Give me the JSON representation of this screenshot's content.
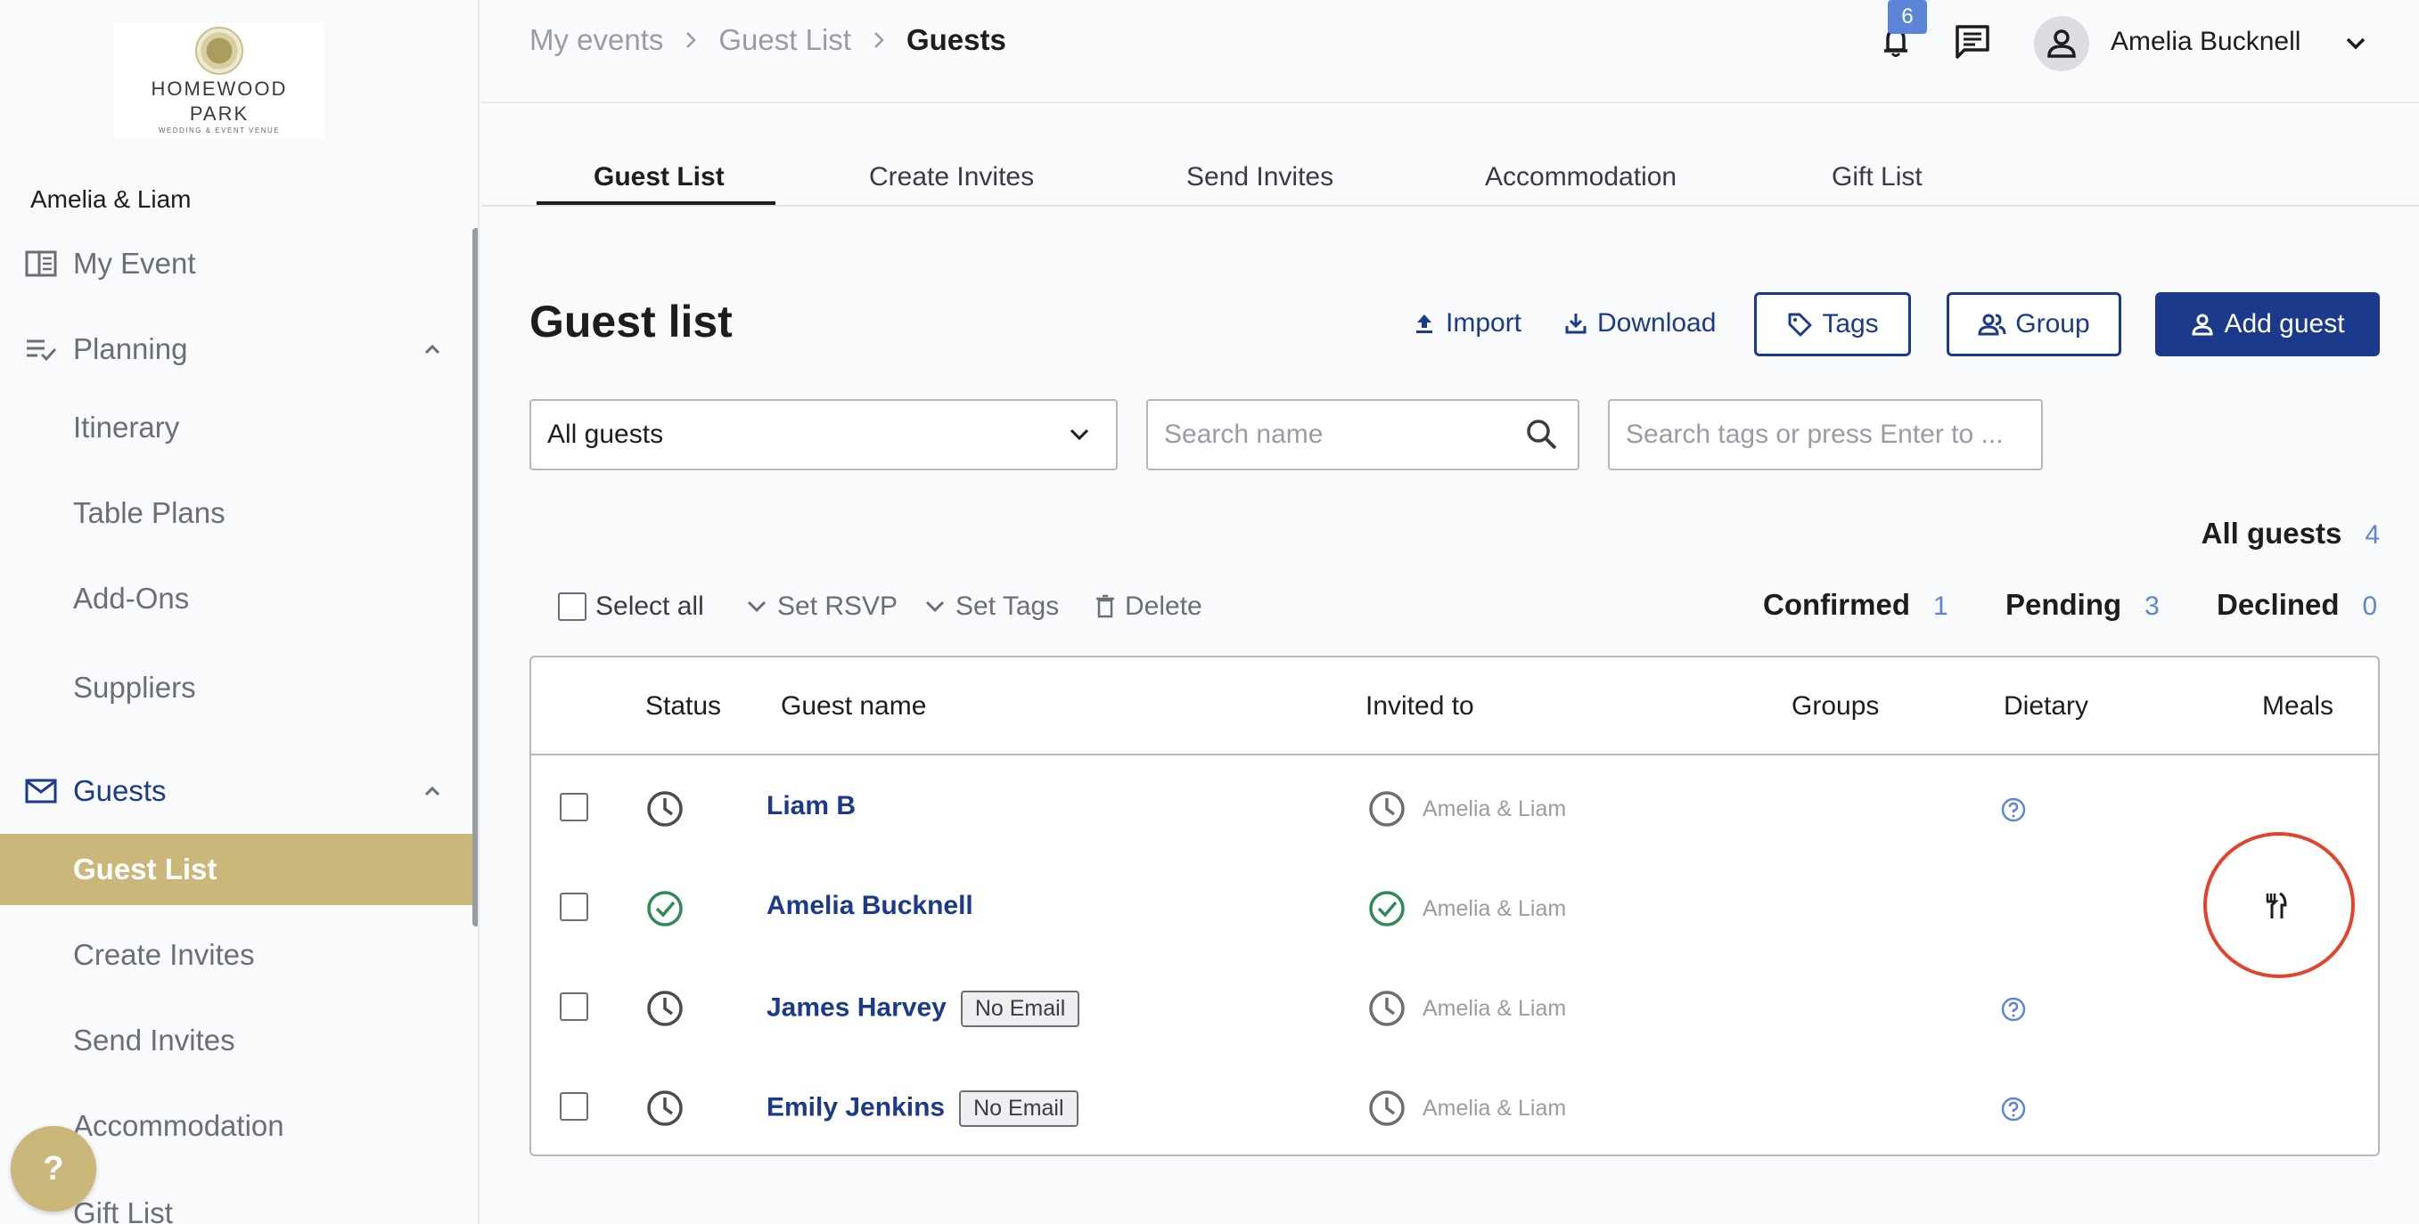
{
  "sidebar": {
    "logo": {
      "line1": "HOMEWOOD",
      "line2": "PARK",
      "tagline": "WEDDING & EVENT VENUE"
    },
    "event_name": "Amelia & Liam",
    "items": [
      {
        "label": "My Event",
        "icon": "book-open-icon"
      },
      {
        "label": "Planning",
        "icon": "checklist-icon"
      },
      {
        "label": "Itinerary"
      },
      {
        "label": "Table Plans"
      },
      {
        "label": "Add-Ons"
      },
      {
        "label": "Suppliers"
      },
      {
        "label": "Guests",
        "icon": "mail-icon"
      },
      {
        "label": "Guest List"
      },
      {
        "label": "Create Invites"
      },
      {
        "label": "Send Invites"
      },
      {
        "label": "Accommodation"
      },
      {
        "label": "Gift List"
      }
    ],
    "help_label": "?"
  },
  "topbar": {
    "breadcrumb": [
      "My events",
      "Guest List",
      "Guests"
    ],
    "notification_count": "6",
    "user_name": "Amelia Bucknell"
  },
  "tabs": [
    "Guest List",
    "Create Invites",
    "Send Invites",
    "Accommodation",
    "Gift List"
  ],
  "main": {
    "title": "Guest list",
    "actions": {
      "import": "Import",
      "download": "Download",
      "tags": "Tags",
      "group": "Group",
      "add_guest": "Add guest"
    },
    "filter_select": "All guests",
    "search_name_placeholder": "Search name",
    "search_tags_placeholder": "Search tags or press Enter to ...",
    "counts": {
      "all_label": "All guests",
      "all": "4",
      "confirmed_label": "Confirmed",
      "confirmed": "1",
      "pending_label": "Pending",
      "pending": "3",
      "declined_label": "Declined",
      "declined": "0"
    },
    "bulk": {
      "select_all": "Select all",
      "set_rsvp": "Set RSVP",
      "set_tags": "Set Tags",
      "delete": "Delete"
    },
    "table": {
      "columns": [
        "Status",
        "Guest name",
        "Invited to",
        "Groups",
        "Dietary",
        "Meals"
      ],
      "rows": [
        {
          "status": "pending",
          "name": "Liam B",
          "badge": "",
          "invited_to": "Amelia & Liam",
          "dietary": "question-icon"
        },
        {
          "status": "confirmed",
          "name": "Amelia Bucknell",
          "badge": "",
          "invited_to": "Amelia & Liam",
          "dietary": ""
        },
        {
          "status": "pending",
          "name": "James Harvey",
          "badge": "No Email",
          "invited_to": "Amelia & Liam",
          "dietary": "question-icon"
        },
        {
          "status": "pending",
          "name": "Emily Jenkins",
          "badge": "No Email",
          "invited_to": "Amelia & Liam",
          "dietary": "question-icon"
        }
      ]
    }
  },
  "colors": {
    "brand": "#1b3a8c",
    "gold": "#ccb77b",
    "accent": "#5b86d8",
    "confirmed": "#2e8b57",
    "highlight": "#e2432a"
  }
}
